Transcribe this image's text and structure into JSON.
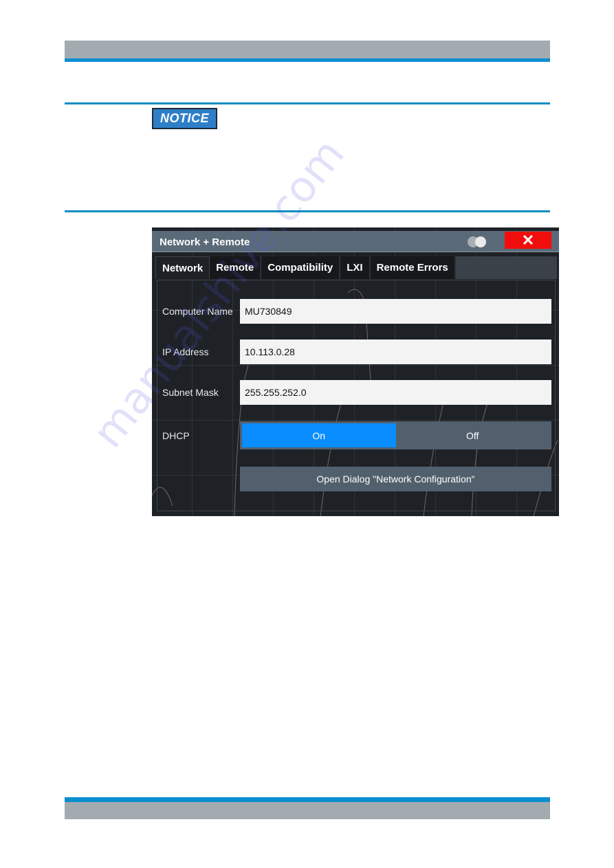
{
  "document": {
    "notice_label": "NOTICE",
    "watermark": "manualshive.com"
  },
  "dialog": {
    "title": "Network + Remote",
    "icons": {
      "toggle": "theme-toggle-icon",
      "close": "close-icon",
      "close_glyph": "✕"
    },
    "tabs": [
      {
        "label": "Network",
        "active": true
      },
      {
        "label": "Remote",
        "active": false
      },
      {
        "label": "Compatibility",
        "active": false
      },
      {
        "label": "LXI",
        "active": false
      },
      {
        "label": "Remote Errors",
        "active": false
      }
    ],
    "fields": {
      "computer_name": {
        "label": "Computer Name",
        "value": "MU730849"
      },
      "ip_address": {
        "label": "IP Address",
        "value": "10.113.0.28"
      },
      "subnet_mask": {
        "label": "Subnet Mask",
        "value": "255.255.252.0"
      }
    },
    "dhcp": {
      "label": "DHCP",
      "options": [
        "On",
        "Off"
      ],
      "selected": "On"
    },
    "open_dialog_button": "Open Dialog \"Network Configuration\""
  },
  "colors": {
    "brand_blue": "#0b8ed0",
    "header_gray": "#a2abb0",
    "selected_blue": "#0a8dff",
    "close_red": "#f20d0d"
  }
}
